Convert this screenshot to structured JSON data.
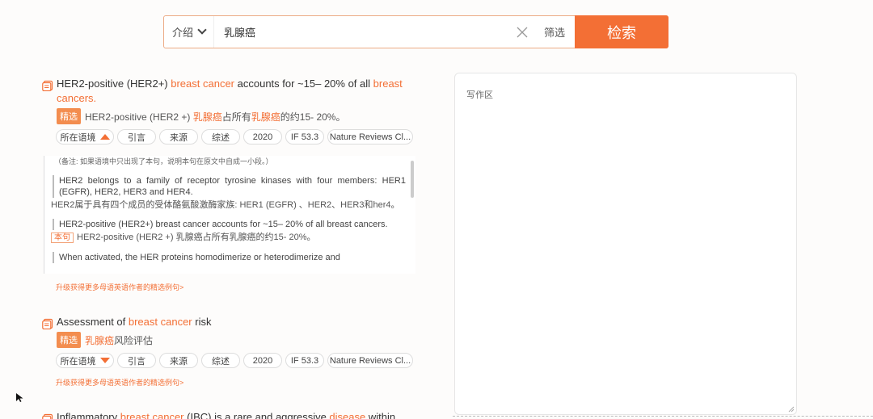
{
  "search": {
    "mode_label": "介绍",
    "query": "乳腺癌",
    "filter_label": "筛选",
    "button_label": "检索"
  },
  "results": [
    {
      "title_parts": [
        "HER2-positive (HER2+) ",
        "breast cancer",
        " accounts for ~15– 20% of all ",
        "breast cancers",
        "."
      ],
      "badge": "精选",
      "translation_parts": [
        "HER2-positive (HER2 +) ",
        "乳腺癌",
        "占所有",
        "乳腺癌",
        "的约15- 20%。"
      ],
      "tags": [
        "所在语境",
        "引言",
        "来源",
        "综述",
        "2020",
        "IF 53.3",
        "Nature Reviews Cl..."
      ],
      "upgrade": "升级获得更多母语英语作者的精选例句>"
    },
    {
      "title_parts": [
        "Assessment of ",
        "breast cancer",
        " risk"
      ],
      "badge": "精选",
      "translation_parts": [
        "乳腺癌",
        "风险评估"
      ],
      "tags": [
        "所在语境",
        "引言",
        "来源",
        "综述",
        "2020",
        "IF 53.3",
        "Nature Reviews Cl..."
      ],
      "upgrade": "升级获得更多母语英语作者的精选例句>"
    },
    {
      "title_parts": [
        "Inflammatory ",
        "breast cancer",
        " (IBC) is a rare and aggressive ",
        "disease",
        " within"
      ]
    }
  ],
  "context": {
    "note": "（备注: 如果语境中只出现了本句，说明本句在原文中自成一小段。）",
    "p1_en": "HER2 belongs to a family of receptor tyrosine kinases with four members: HER1 (EGFR), HER2, HER3 and HER4.",
    "p1_cn": "HER2属于具有四个成员的受体酪氨酸激酶家族: HER1 (EGFR) 、HER2、HER3和her4。",
    "p2_en": "HER2-positive (HER2+) breast cancer accounts for ~15– 20% of all breast cancers.",
    "p2_tag": "本句",
    "p2_cn": "HER2-positive (HER2 +) 乳腺癌占所有乳腺癌的约15- 20%。",
    "p3_en": "When activated, the HER proteins homodimerize or heterodimerize and"
  },
  "write_area": {
    "label": "写作区"
  },
  "colors": {
    "accent": "#f36f35",
    "badge": "#f38d4f"
  }
}
